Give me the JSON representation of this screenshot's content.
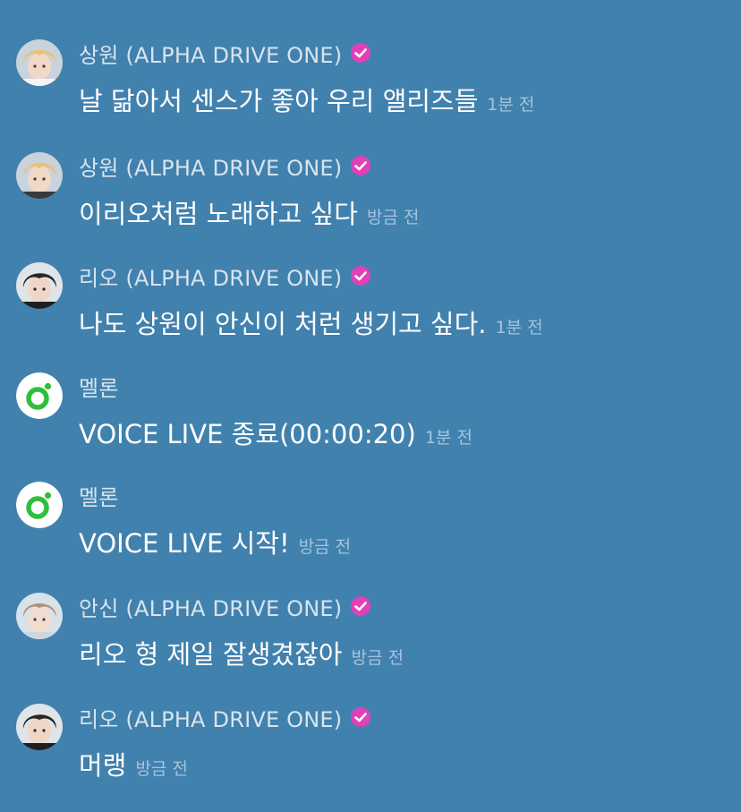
{
  "colors": {
    "background": "#4181ae",
    "name_text": "#d7e4ee",
    "message_text": "#ffffff",
    "time_text": "#a6c4dc",
    "verified_badge": "#e040b8",
    "melon_green": "#2fbf3b"
  },
  "messages": [
    {
      "avatar_icon": "blonde-member-avatar-icon",
      "name": "상원 (ALPHA DRIVE ONE)",
      "verified": true,
      "text": "날 닮아서 센스가 좋아 우리 앨리즈들",
      "time": "1분 전"
    },
    {
      "avatar_icon": "blonde-member-avatar-icon",
      "name": "상원 (ALPHA DRIVE ONE)",
      "verified": true,
      "text": "이리오처럼 노래하고 싶다",
      "time": "방금 전"
    },
    {
      "avatar_icon": "dark-hair-member-avatar-icon",
      "name": "리오 (ALPHA DRIVE ONE)",
      "verified": true,
      "text": "나도 상원이 안신이 처런 생기고 싶다.",
      "time": "1분 전"
    },
    {
      "avatar_icon": "melon-logo-icon",
      "name": "멜론",
      "verified": false,
      "text": "VOICE LIVE 종료(00:00:20)",
      "time": "1분 전"
    },
    {
      "avatar_icon": "melon-logo-icon",
      "name": "멜론",
      "verified": false,
      "text": "VOICE LIVE 시작!",
      "time": "방금 전"
    },
    {
      "avatar_icon": "light-hair-member-avatar-icon",
      "name": "안신 (ALPHA DRIVE ONE)",
      "verified": true,
      "text": "리오 형 제일 잘생겼잖아",
      "time": "방금 전"
    },
    {
      "avatar_icon": "dark-hair-member-avatar-icon",
      "name": "리오 (ALPHA DRIVE ONE)",
      "verified": true,
      "text": "머랭",
      "time": "방금 전"
    }
  ]
}
